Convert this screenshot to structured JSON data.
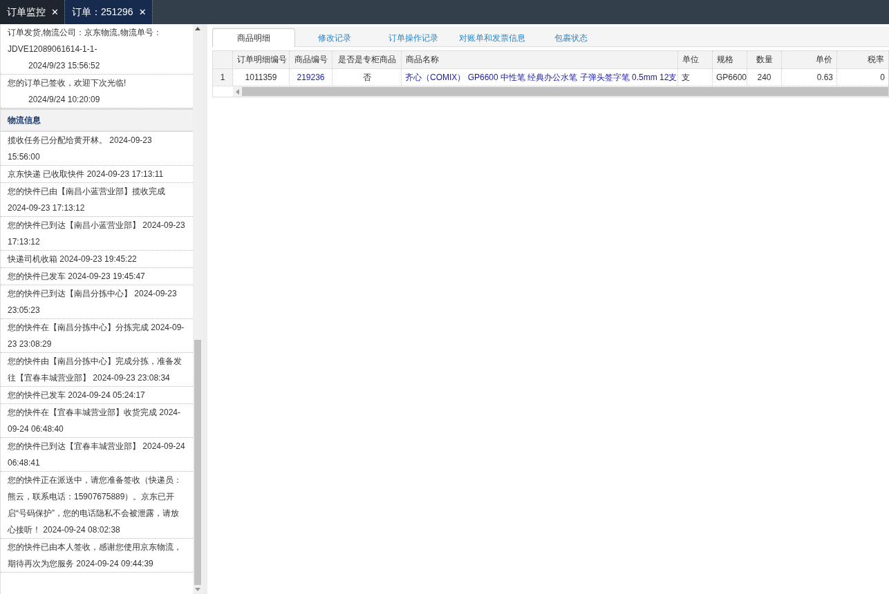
{
  "top_tabs": [
    {
      "label": "订单监控",
      "close": "✕",
      "selected": false
    },
    {
      "label": "订单：251296",
      "close": "✕",
      "selected": true
    }
  ],
  "order_status": [
    {
      "text": "订单发货,物流公司：京东物流,物流单号：JDVE12089061614-1-1-",
      "time": "2024/9/23 15:56:52"
    },
    {
      "text": "您的订单已签收，欢迎下次光临!",
      "time": "2024/9/24 10:20:09"
    }
  ],
  "logistics": {
    "title": "物流信息",
    "items": [
      "揽收任务已分配给黄开林。 2024-09-23 15:56:00",
      "京东快递 已收取快件 2024-09-23 17:13:11",
      "您的快件已由【南昌小蓝营业部】揽收完成 2024-09-23 17:13:12",
      "您的快件已到达【南昌小蓝营业部】 2024-09-23 17:13:12",
      "快递司机收箱 2024-09-23 19:45:22",
      "您的快件已发车 2024-09-23 19:45:47",
      "您的快件已到达【南昌分拣中心】 2024-09-23 23:05:23",
      "您的快件在【南昌分拣中心】分拣完成 2024-09-23 23:08:29",
      "您的快件由【南昌分拣中心】完成分拣，准备发往【宜春丰城营业部】 2024-09-23 23:08:34",
      "您的快件已发车 2024-09-24 05:24:17",
      "您的快件在【宜春丰城营业部】收货完成 2024-09-24 06:48:40",
      "您的快件已到达【宜春丰城营业部】 2024-09-24 06:48:41",
      "您的快件正在派送中，请您准备签收（快递员：熊云，联系电话：15907675889）。京东已开启“号码保护”，您的电话隐私不会被泄露，请放心接听！ 2024-09-24 08:02:38",
      "您的快件已由本人签收，感谢您使用京东物流，期待再次为您服务 2024-09-24 09:44:39"
    ]
  },
  "detail_tabs": [
    {
      "label": "商品明细",
      "selected": true
    },
    {
      "label": "修改记录",
      "selected": false
    },
    {
      "label": "订单操作记录",
      "selected": false
    },
    {
      "label": "对账单和发票信息",
      "selected": false
    },
    {
      "label": "包裹状态",
      "selected": false
    }
  ],
  "table": {
    "columns": [
      "订单明细编号",
      "商品编号",
      "是否是专柜商品",
      "商品名称",
      "单位",
      "规格",
      "数量",
      "单价",
      "税率"
    ],
    "rows": [
      {
        "index": "1",
        "cells": [
          "1011359",
          "219236",
          "否",
          "齐心（COMIX） GP6600 中性笔 经典办公水笔 子弹头签字笔 0.5mm 12支",
          "支",
          "GP6600",
          "240",
          "0.63",
          "0"
        ]
      }
    ]
  }
}
